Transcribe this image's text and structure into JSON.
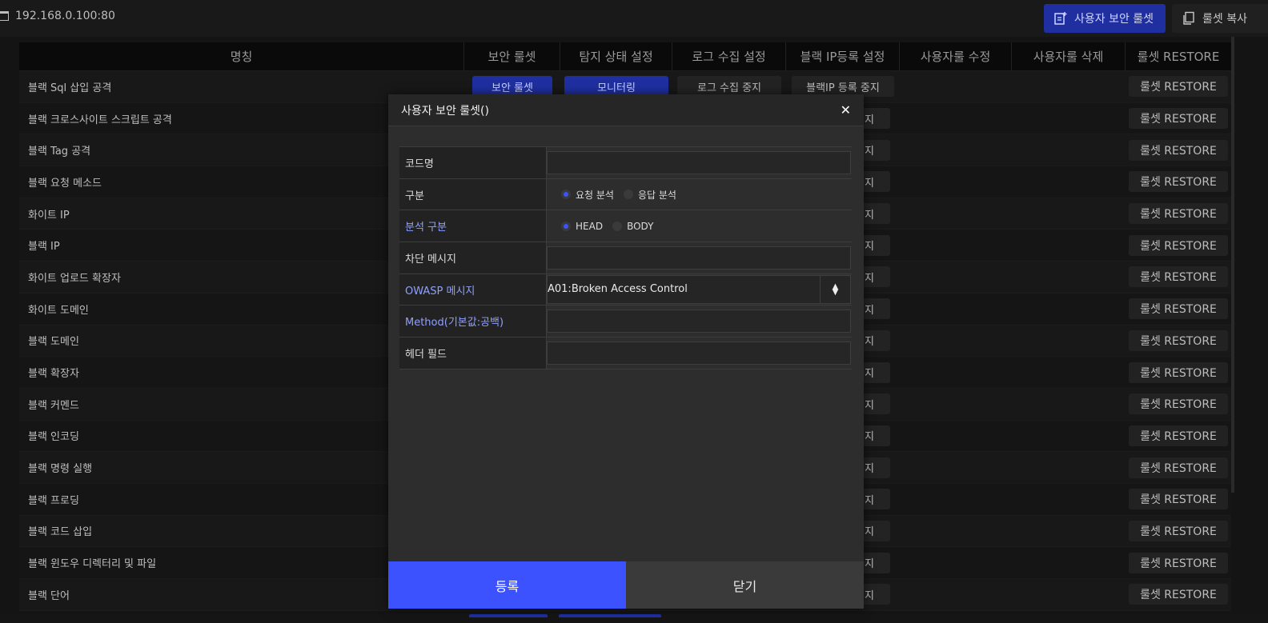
{
  "address": "192.168.0.100:80",
  "toolbar": {
    "user_ruleset_label": "사용자 보안 룰셋",
    "copy_ruleset_label": "룰셋 복사"
  },
  "table": {
    "headers": [
      "명칭",
      "보안 룰셋",
      "탐지 상태 설정",
      "로그 수집 설정",
      "블랙 IP등록 설정",
      "사용자룰 수정",
      "사용자룰 삭제",
      "룰셋 RESTORE"
    ],
    "first_row_buttons": {
      "ruleset": "보안 룰셋",
      "monitor": "모니터링",
      "log_stop": "로그 수집 중지",
      "blackip_stop": "블랙IP 등록 중지"
    },
    "stub_text": "지",
    "restore_label": "룰셋 RESTORE",
    "rows": [
      "블랙 Sql 삽입 공격",
      "블랙 크로스사이트 스크립트 공격",
      "블랙 Tag 공격",
      "블랙 요청 메소드",
      "화이트 IP",
      "블랙 IP",
      "화이트 업로드 확장자",
      "화이트 도메인",
      "블랙 도메인",
      "블랙 확장자",
      "블랙 커멘드",
      "블랙 인코딩",
      "블랙 명령 실행",
      "블랙 프로딩",
      "블랙 코드 삽입",
      "블랙 윈도우 디렉터리 및 파일",
      "블랙 단어"
    ]
  },
  "modal": {
    "title": "사용자 보안 룰셋()",
    "fields": {
      "code_name": "코드명",
      "category": "구분",
      "category_opt1": "요청 분석",
      "category_opt2": "응답 분석",
      "analysis": "분석 구분",
      "analysis_opt1": "HEAD",
      "analysis_opt2": "BODY",
      "block_msg": "차단 메시지",
      "owasp": "OWASP 메시지",
      "owasp_value": "A01:Broken Access Control",
      "method": "Method(기본값:공백)",
      "header_field": "헤더 필드"
    },
    "submit_label": "등록",
    "close_label": "닫기"
  }
}
